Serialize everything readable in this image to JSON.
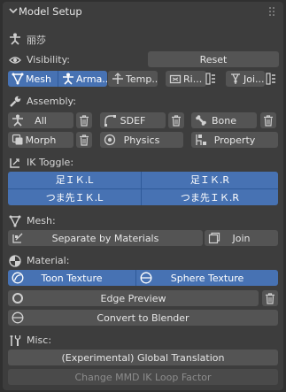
{
  "panel": {
    "title": "Model Setup",
    "model_name": "丽莎"
  },
  "visibility": {
    "label": "Visibility:",
    "reset_label": "Reset",
    "tabs": [
      {
        "label": "Mesh",
        "active": true
      },
      {
        "label": "Arma...",
        "active": true
      },
      {
        "label": "Temp...",
        "active": false
      },
      {
        "label": "Ri...",
        "active": false
      },
      {
        "label": "Joi...",
        "active": false
      }
    ]
  },
  "assembly": {
    "label": "Assembly:",
    "all_label": "All",
    "sdef_label": "SDEF",
    "bone_label": "Bone",
    "morph_label": "Morph",
    "physics_label": "Physics",
    "property_label": "Property"
  },
  "ik_toggle": {
    "label": "IK Toggle:",
    "buttons": [
      "足ＩＫ.L",
      "足ＩＫ.R",
      "つま先ＩＫ.L",
      "つま先ＩＫ.R"
    ]
  },
  "mesh": {
    "label": "Mesh:",
    "separate_label": "Separate by Materials",
    "join_label": "Join"
  },
  "material": {
    "label": "Material:",
    "toon_label": "Toon Texture",
    "sphere_label": "Sphere Texture",
    "edge_label": "Edge Preview",
    "convert_label": "Convert to Blender"
  },
  "misc": {
    "label": "Misc:",
    "global_translation_label": "(Experimental) Global Translation",
    "ik_loop_label": "Change MMD IK Loop Factor"
  },
  "colors": {
    "accent": "#4772b3",
    "button": "#545454",
    "panel": "#3d3d3d",
    "background": "#303030"
  }
}
